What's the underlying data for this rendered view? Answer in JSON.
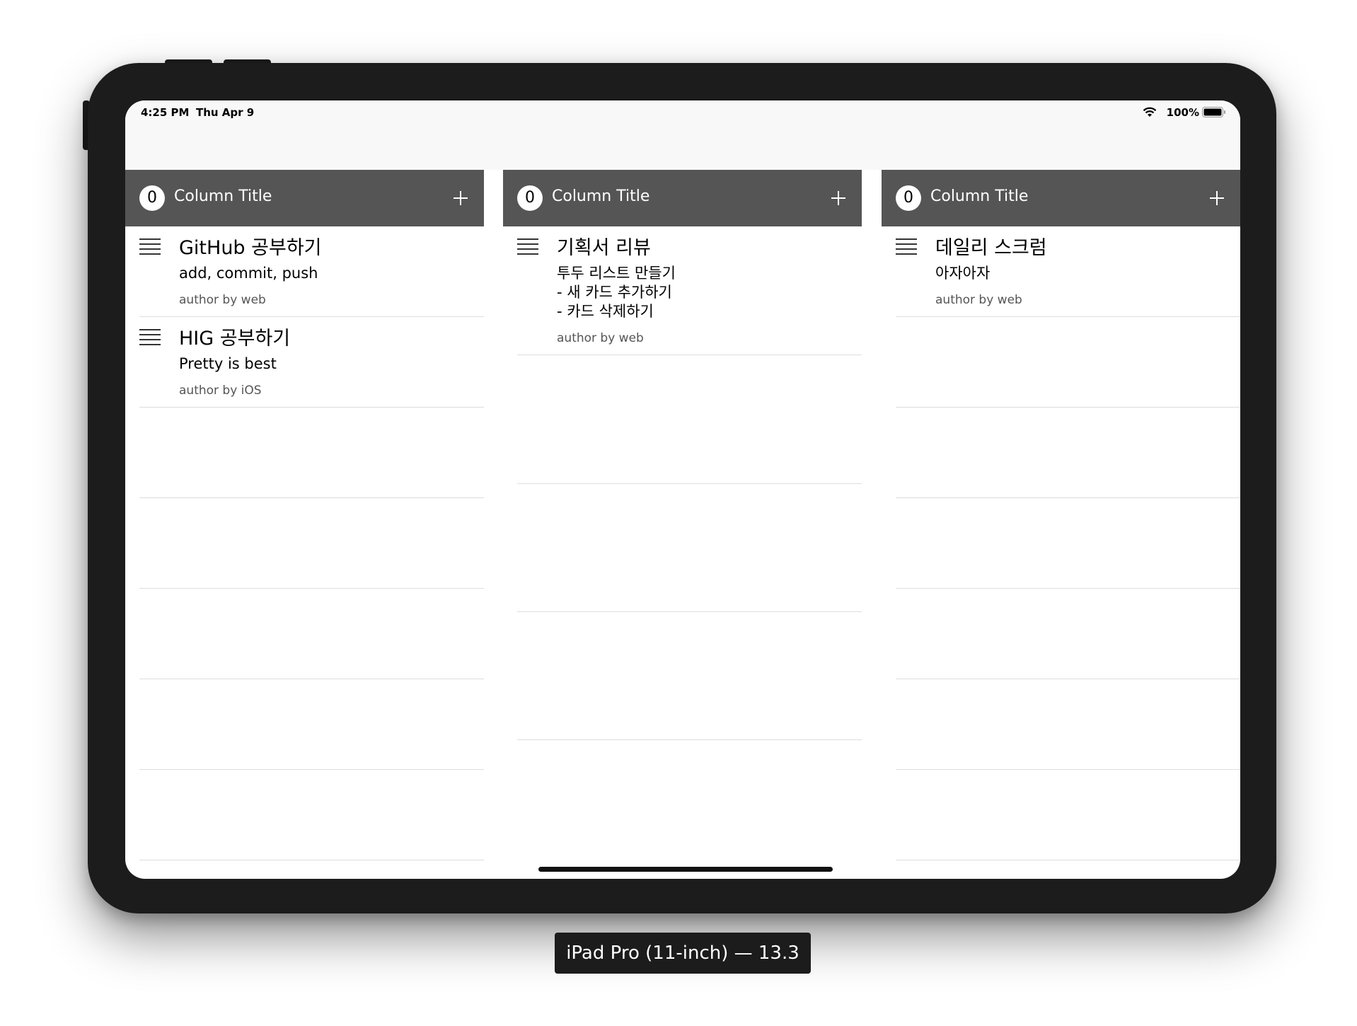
{
  "statusbar": {
    "time": "4:25 PM",
    "date": "Thu Apr 9",
    "battery_percent": "100%",
    "wifi_icon": "wifi-icon",
    "battery_icon": "battery-icon"
  },
  "columns": [
    {
      "count": "0",
      "title": "Column Title",
      "add_icon": "plus-icon",
      "cards": [
        {
          "title": "GitHub 공부하기",
          "body": "add, commit, push",
          "author": "author by web"
        },
        {
          "title": "HIG 공부하기",
          "body": "Pretty is best",
          "author": "author by iOS"
        }
      ]
    },
    {
      "count": "0",
      "title": "Column Title",
      "add_icon": "plus-icon",
      "cards": [
        {
          "title": "기획서 리뷰",
          "body": "투두 리스트 만들기\n- 새 카드 추가하기\n- 카드 삭제하기",
          "author": "author by web"
        }
      ]
    },
    {
      "count": "0",
      "title": "Column Title",
      "add_icon": "plus-icon",
      "cards": [
        {
          "title": "데일리 스크럼",
          "body": "아자아자",
          "author": "author by web"
        }
      ]
    }
  ],
  "device_label": "iPad Pro (11-inch) — 13.3"
}
